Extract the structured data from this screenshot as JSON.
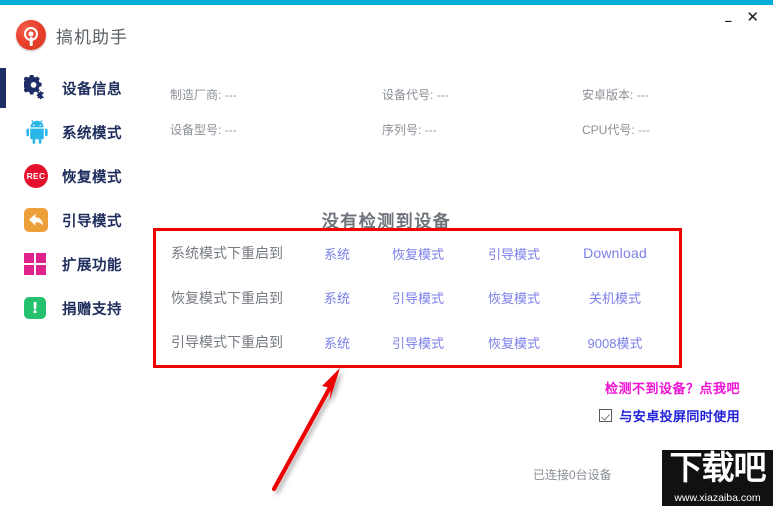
{
  "window": {
    "accent_color": "#00ACD8",
    "minimize_label": "–",
    "close_label": "✕"
  },
  "brand": {
    "title": "搞机助手",
    "logo_icon": "target-search-icon",
    "logo_color": "#e8412c"
  },
  "sidebar": {
    "items": [
      {
        "label": "设备信息",
        "icon": "gear-icon",
        "active": true
      },
      {
        "label": "系统模式",
        "icon": "android-icon",
        "active": false
      },
      {
        "label": "恢复模式",
        "icon": "rec-icon",
        "active": false,
        "icon_text": "REC"
      },
      {
        "label": "引导模式",
        "icon": "back-arrow-icon",
        "active": false
      },
      {
        "label": "扩展功能",
        "icon": "grid-icon",
        "active": false
      },
      {
        "label": "捐赠支持",
        "icon": "exclamation-icon",
        "active": false,
        "icon_text": "!"
      }
    ]
  },
  "device_info": {
    "rows": [
      [
        {
          "label": "制造厂商:",
          "value": "---"
        },
        {
          "label": "设备代号:",
          "value": "---"
        },
        {
          "label": "安卓版本:",
          "value": "---"
        }
      ],
      [
        {
          "label": "设备型号:",
          "value": "---"
        },
        {
          "label": "序列号:",
          "value": "---"
        },
        {
          "label": "CPU代号:",
          "value": "---"
        }
      ]
    ]
  },
  "main": {
    "heading": "没有检测到设备",
    "highlight_border_color": "#f20000",
    "action_table": {
      "rows": [
        {
          "label": "系统模式下重启到",
          "cells": [
            {
              "text": "系统",
              "selected": false
            },
            {
              "text": "恢复模式",
              "selected": true
            },
            {
              "text": "引导模式",
              "selected": false
            },
            {
              "text": "Download",
              "selected": false
            }
          ]
        },
        {
          "label": "恢复模式下重启到",
          "cells": [
            {
              "text": "系统",
              "selected": false
            },
            {
              "text": "引导模式",
              "selected": false
            },
            {
              "text": "恢复模式",
              "selected": false
            },
            {
              "text": "关机模式",
              "selected": false
            }
          ]
        },
        {
          "label": "引导模式下重启到",
          "cells": [
            {
              "text": "系统",
              "selected": false
            },
            {
              "text": "引导模式",
              "selected": false
            },
            {
              "text": "恢复模式",
              "selected": false
            },
            {
              "text": "9008模式",
              "selected": false
            }
          ]
        }
      ]
    },
    "annotation_arrow": {
      "icon": "red-arrow-icon",
      "color": "#ee0000"
    }
  },
  "footer": {
    "help_link": "检测不到设备？点我吧",
    "help_link_color": "#ef12d4",
    "checkbox_label": "与安卓投屏同时使用",
    "checkbox_checked": true,
    "status": "已连接0台设备"
  },
  "watermark": {
    "text": "下载吧",
    "url": "www.xiazaiba.com"
  }
}
